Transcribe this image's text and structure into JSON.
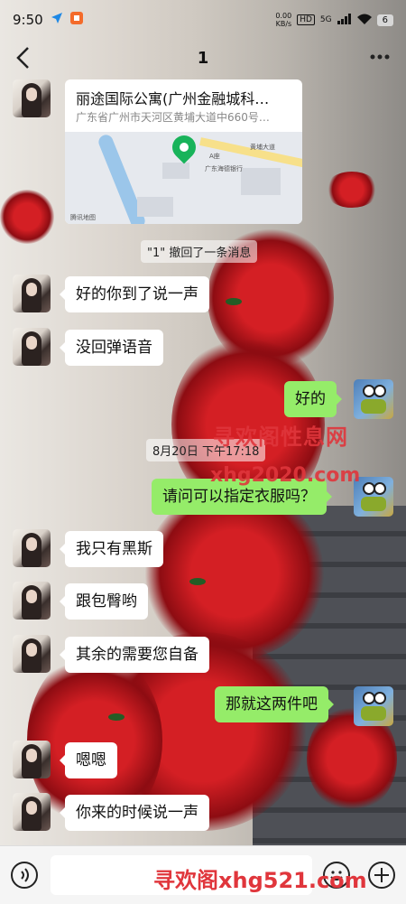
{
  "status_bar": {
    "time": "9:50",
    "network_speed": "0.00\nKB/s",
    "hd_label": "HD",
    "signal_label": "5G",
    "battery": "6",
    "icons": [
      "location-arrow-icon",
      "app-badge-icon",
      "hd-icon",
      "signal-icon",
      "wifi-icon",
      "battery-icon"
    ]
  },
  "header": {
    "title": "1",
    "back_icon": "chevron-left-icon",
    "more_icon": "more-dots-icon"
  },
  "location_card": {
    "title": "丽途国际公寓(广州金融城科…",
    "address": "广东省广州市天河区黄埔大道中660号…",
    "map_labels": [
      "黄埔大道",
      "A座",
      "广东海德银行",
      "腾讯地图"
    ]
  },
  "system_messages": {
    "recalled": "\"1\" 撤回了一条消息",
    "timestamp": "8月20日 下午17:18"
  },
  "messages": [
    {
      "side": "in",
      "text": "好的你到了说一声"
    },
    {
      "side": "in",
      "text": "没回弹语音"
    },
    {
      "side": "out",
      "text": "好的"
    },
    {
      "side": "out",
      "text": "请问可以指定衣服吗？"
    },
    {
      "side": "in",
      "text": "我只有黑斯"
    },
    {
      "side": "in",
      "text": "跟包臀哟"
    },
    {
      "side": "in",
      "text": "其余的需要您自备"
    },
    {
      "side": "out",
      "text": "那就这两件吧"
    },
    {
      "side": "in",
      "text": "嗯嗯"
    },
    {
      "side": "in",
      "text": "你来的时候说一声"
    }
  ],
  "watermarks": {
    "line1": "寻欢阁性息网",
    "line2": "xhg2020.com",
    "line3": "寻欢阁xhg521.com"
  },
  "bottom_bar": {
    "input_value": "",
    "icons": [
      "voice-icon",
      "emoji-icon",
      "plus-icon"
    ]
  },
  "colors": {
    "bubble_out": "#95ec69",
    "bubble_in": "#ffffff",
    "watermark": "#e0363c",
    "map_pin": "#18b35a"
  }
}
